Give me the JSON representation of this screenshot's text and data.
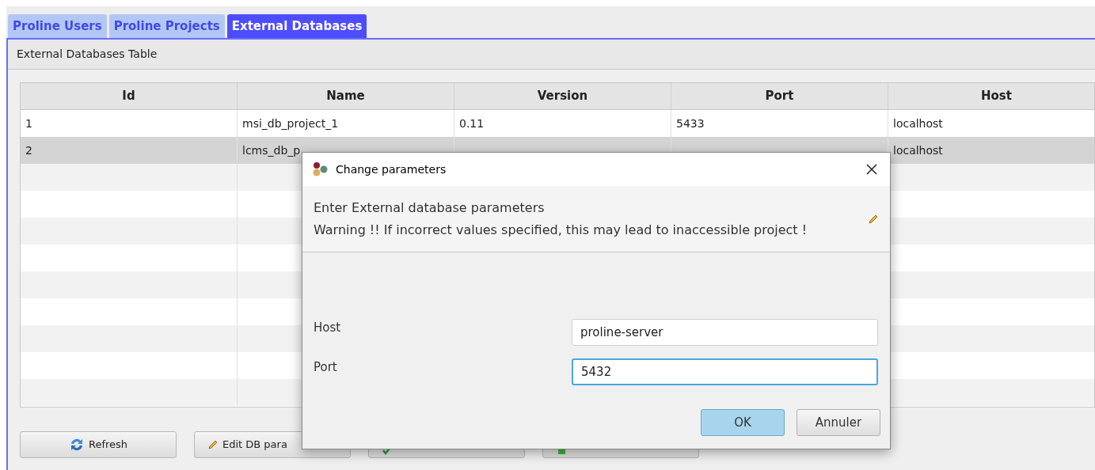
{
  "tabs": [
    {
      "label": "Proline Users",
      "selected": false
    },
    {
      "label": "Proline Projects",
      "selected": false
    },
    {
      "label": "External Databases",
      "selected": true
    }
  ],
  "panel_title": "External Databases Table",
  "table": {
    "columns": [
      "Id",
      "Name",
      "Version",
      "Port",
      "Host"
    ],
    "rows": [
      {
        "cells": [
          "1",
          "msi_db_project_1",
          "0.11",
          "5433",
          "localhost"
        ],
        "selected": false
      },
      {
        "cells": [
          "2",
          "lcms_db_p",
          null,
          null,
          "localhost"
        ],
        "selected": true
      }
    ]
  },
  "buttons": [
    {
      "label": "Refresh",
      "kind": "refresh"
    },
    {
      "label": "Edit DB para",
      "kind": "edit"
    },
    {
      "kind": "check"
    },
    {
      "kind": "upgrade"
    }
  ],
  "dialog": {
    "title": "Change parameters",
    "heading": "Enter External database parameters",
    "warning": "Warning !! If incorrect values specified, this may lead to inaccessible project !",
    "fields": [
      {
        "label": "Host",
        "value": "proline-server",
        "focused": false
      },
      {
        "label": "Port",
        "value": "5432",
        "focused": true
      }
    ],
    "buttons": [
      {
        "label": "OK",
        "default": true
      },
      {
        "label": "Annuler",
        "default": false
      }
    ]
  }
}
